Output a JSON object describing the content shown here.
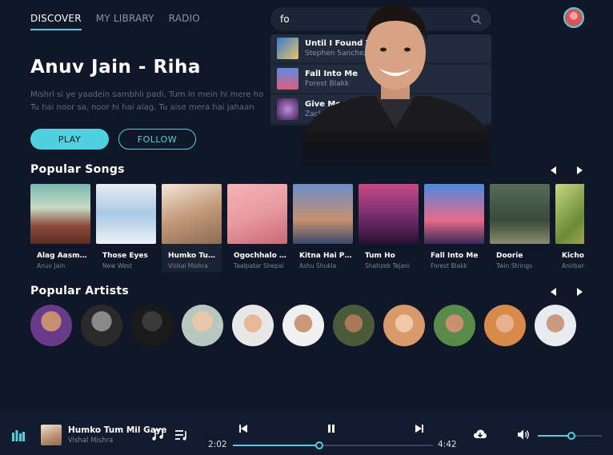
{
  "nav": {
    "items": [
      {
        "label": "DISCOVER",
        "active": true
      },
      {
        "label": "MY LIBRARY",
        "active": false
      },
      {
        "label": "RADIO",
        "active": false
      }
    ]
  },
  "search": {
    "value": "fo",
    "icon": "search-icon"
  },
  "suggestions": [
    {
      "title": "Until I Found You",
      "artist": "Stephen Sanchez"
    },
    {
      "title": "Fall Into Me",
      "artist": "Forest Blakk"
    },
    {
      "title": "Give Me Your Forever",
      "artist": "Zack Tabudlo"
    }
  ],
  "hero": {
    "title": "Anuv Jain - Riha",
    "lyric_line1": "Mishri si ye yaadein sambhli padi, Tum in mein hi mere ho",
    "lyric_line2": "Tu hai noor sa, noor hi hai alag, Tu aise mera hai jahaan",
    "play_label": "PLAY",
    "follow_label": "FOLLOW"
  },
  "popular_songs": {
    "title": "Popular Songs",
    "items": [
      {
        "title": "Alag Aasmaan",
        "artist": "Anuv Jain"
      },
      {
        "title": "Those Eyes",
        "artist": "New West"
      },
      {
        "title": "Humko Tum Mil Gaye",
        "artist": "Vishal Mishra"
      },
      {
        "title": "Ogochhalo Mon",
        "artist": "Taalpatar Shepai"
      },
      {
        "title": "Kitna Hai Pyaar",
        "artist": "Ashu Shukla"
      },
      {
        "title": "Tum Ho",
        "artist": "Shahzeb Tejani"
      },
      {
        "title": "Fall Into Me",
        "artist": "Forest Blakk"
      },
      {
        "title": "Doorie",
        "artist": "Twin Strings"
      },
      {
        "title": "Kichou",
        "artist": "Anirban"
      }
    ]
  },
  "popular_artists": {
    "title": "Popular Artists"
  },
  "player": {
    "title": "Humko Tum Mil Gaye",
    "artist": "Vishal Mishra",
    "current_time": "2:02",
    "total_time": "4:42",
    "progress": 0.43,
    "volume": 0.52
  },
  "colors": {
    "accent": "#4fd1e0",
    "background": "#0f1729",
    "panel": "#1c2537"
  }
}
